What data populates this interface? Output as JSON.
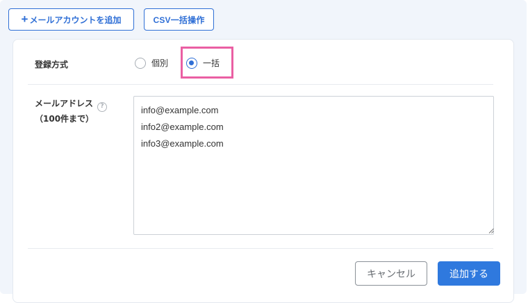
{
  "toolbar": {
    "add_account_icon": "plus-icon",
    "add_account_label": "メールアカウントを追加",
    "csv_label": "CSV一括操作"
  },
  "form": {
    "registration_method": {
      "label": "登録方式",
      "options": [
        {
          "label": "個別",
          "checked": false
        },
        {
          "label": "一括",
          "checked": true
        }
      ]
    },
    "email": {
      "label": "メールアドレス",
      "sublabel": "（100件まで）",
      "help_icon": "?",
      "value": "info@example.com\ninfo2@example.com\ninfo3@example.com"
    }
  },
  "actions": {
    "cancel_label": "キャンセル",
    "submit_label": "追加する"
  },
  "colors": {
    "accent": "#2f6fd6",
    "primary_button": "#2f79de",
    "highlight": "#ea5fa3",
    "background": "#f1f5fb"
  }
}
